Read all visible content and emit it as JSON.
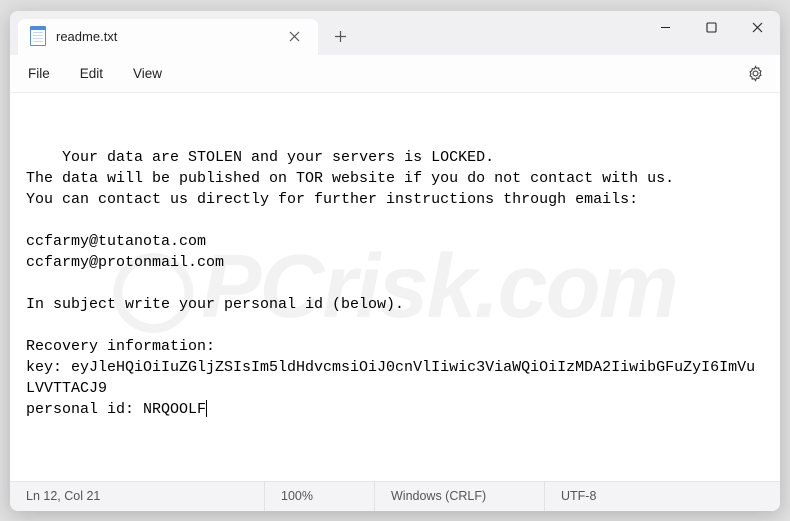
{
  "titlebar": {
    "tab_title": "readme.txt"
  },
  "menu": {
    "file": "File",
    "edit": "Edit",
    "view": "View"
  },
  "body_text": "Your data are STOLEN and your servers is LOCKED.\nThe data will be published on TOR website if you do not contact with us.\nYou can contact us directly for further instructions through emails:\n\nccfarmy@tutanota.com\nccfarmy@protonmail.com\n\nIn subject write your personal id (below).\n\nRecovery information:\nkey: eyJleHQiOiIuZGljZSIsIm5ldHdvcmsiOiJ0cnVlIiwic3ViaWQiOiIzMDA2IiwibGFuZyI6ImVuLVVTTACJ9\npersonal id: NRQOOLF",
  "statusbar": {
    "position": "Ln 12, Col 21",
    "zoom": "100%",
    "line_ending": "Windows (CRLF)",
    "encoding": "UTF-8"
  }
}
